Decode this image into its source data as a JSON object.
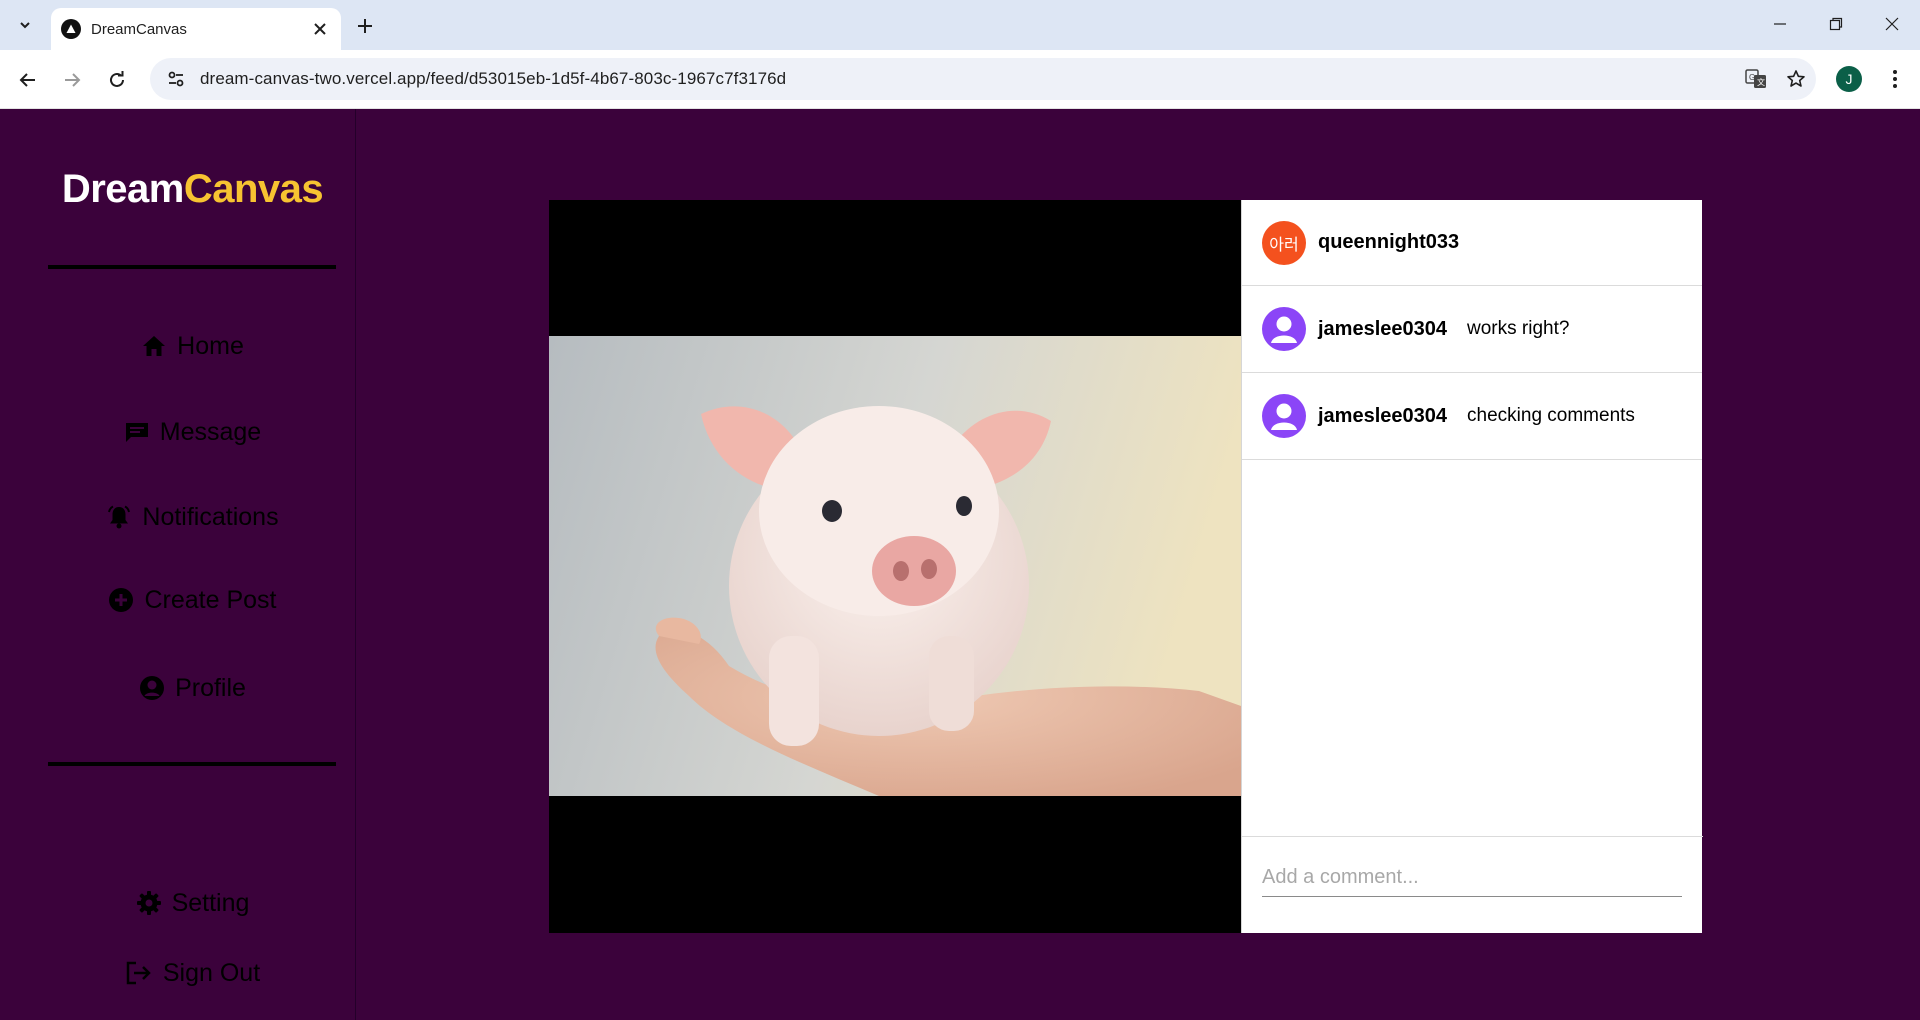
{
  "browser": {
    "tab_title": "DreamCanvas",
    "url": "dream-canvas-two.vercel.app/feed/d53015eb-1d5f-4b67-803c-1967c7f3176d",
    "profile_initial": "J"
  },
  "sidebar": {
    "brand_part1": "Dream",
    "brand_part2": "Canvas",
    "nav": [
      {
        "label": "Home",
        "icon": "home-icon"
      },
      {
        "label": "Message",
        "icon": "message-icon"
      },
      {
        "label": "Notifications",
        "icon": "bell-icon"
      },
      {
        "label": "Create Post",
        "icon": "plus-circle-icon"
      },
      {
        "label": "Profile",
        "icon": "user-circle-icon"
      }
    ],
    "footer": [
      {
        "label": "Setting",
        "icon": "gear-icon"
      },
      {
        "label": "Sign Out",
        "icon": "sign-out-icon"
      }
    ]
  },
  "post": {
    "author": {
      "avatar_text": "아러",
      "username": "queennight033"
    },
    "comments": [
      {
        "username": "jameslee0304",
        "text": "works right?"
      },
      {
        "username": "jameslee0304",
        "text": "checking comments"
      }
    ],
    "comment_placeholder": "Add a comment..."
  },
  "colors": {
    "background": "#3b023b",
    "brand_accent": "#f7c331",
    "author_avatar": "#f4511e",
    "commenter_avatar": "#8b45f7"
  }
}
